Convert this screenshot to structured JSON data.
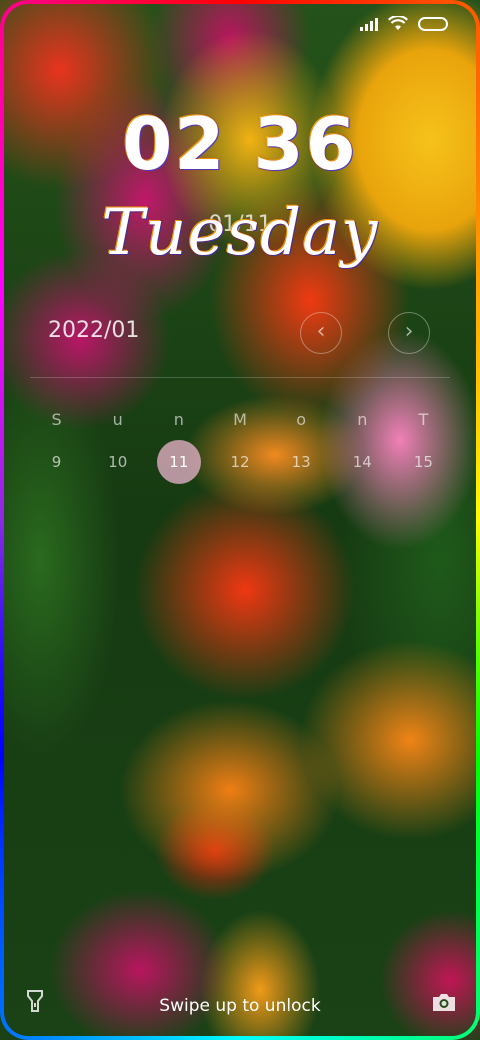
{
  "status_bar": {
    "icons": [
      "signal-icon",
      "wifi-icon",
      "battery-icon"
    ]
  },
  "lockscreen": {
    "time": "02 36",
    "date": "01/11",
    "weekday": "Tuesday"
  },
  "calendar": {
    "month": "2022/01",
    "prev_icon": "‹",
    "next_icon": "›",
    "day_names": [
      "S",
      "u",
      "n",
      "M",
      "o",
      "n",
      "T"
    ],
    "days": [
      "9",
      "10",
      "11",
      "12",
      "13",
      "14",
      "15"
    ],
    "selected_day": "11"
  },
  "bottom": {
    "unlock_text": "Swipe up to unlock",
    "left_icon": "flashlight-icon",
    "right_icon": "camera-icon"
  },
  "colors": {
    "selected_day_bg": "#ecb4cd",
    "text": "#ffffff"
  }
}
